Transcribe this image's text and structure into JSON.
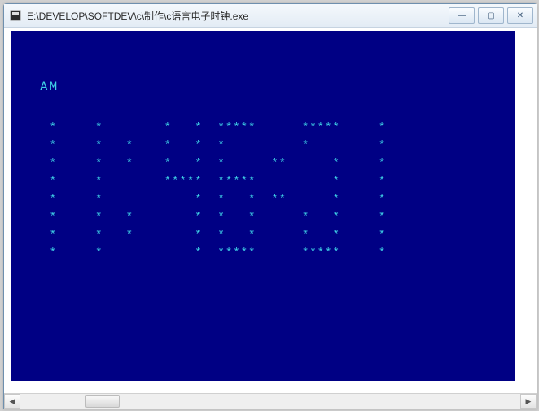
{
  "window": {
    "title": "E:\\DEVELOP\\SOFTDEV\\c\\制作\\c语言电子时钟.exe",
    "buttons": {
      "minimize": "—",
      "maximize": "▢",
      "close": "✕"
    }
  },
  "console": {
    "ampm": "AM",
    "time_string": "11:46:31",
    "digits": [
      "1",
      "1",
      ":",
      "4",
      "6",
      ":",
      "3",
      "1"
    ],
    "rows": [
      "    *     *        *   *  *****      *****     * ",
      "    *     *   *    *   *  *          *         * ",
      "    *     *   *    *   *  *      **      *     * ",
      "    *     *        *****  *****          *     * ",
      "    *     *            *  *   *  **      *     * ",
      "    *     *   *        *  *   *      *   *     * ",
      "    *     *   *        *  *   *      *   *     * ",
      "    *     *            *  *****      *****     * "
    ],
    "colors": {
      "background": "#000084",
      "foreground": "#3fd2e6"
    }
  },
  "scrollbar": {
    "left_arrow": "◀",
    "right_arrow": "▶"
  }
}
